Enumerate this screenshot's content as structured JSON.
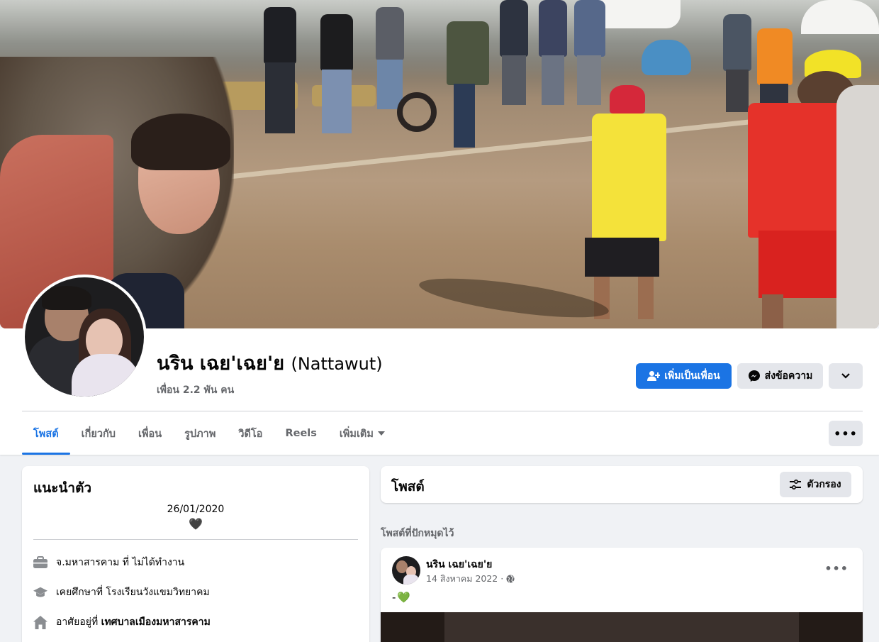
{
  "colors": {
    "accent": "#1b74e4",
    "secondary_button_bg": "#e4e6eb",
    "page_bg": "#f0f2f5",
    "muted_text": "#65676b"
  },
  "profile": {
    "name": "นริน เฉย'เฉย'ย",
    "alternate_name": "(Nattawut)",
    "friends_count": "เพื่อน 2.2 พัน คน",
    "actions": {
      "add_friend": "เพิ่มเป็นเพื่อน",
      "message": "ส่งข้อความ"
    }
  },
  "tabs": [
    {
      "label": "โพสต์",
      "active": true
    },
    {
      "label": "เกี่ยวกับ"
    },
    {
      "label": "เพื่อน"
    },
    {
      "label": "รูปภาพ"
    },
    {
      "label": "วิดีโอ"
    },
    {
      "label": "Reels"
    },
    {
      "label": "เพิ่มเติม"
    }
  ],
  "intro": {
    "title": "แนะนำตัว",
    "bio_date": "26/01/2020",
    "bio_symbol": "🖤",
    "work": "จ.มหาสารคาม ที่ ไม่ได้ทำงาน",
    "education": "เคยศึกษาที่ โรงเรียนวังแขมวิทยาคม",
    "lives_prefix": "อาศัยอยู่ที่",
    "lives_place": "เทศบาลเมืองมหาสารคาม"
  },
  "posts": {
    "title": "โพสต์",
    "filter_label": "ตัวกรอง",
    "pinned_label": "โพสต์ที่ปักหมุดไว้",
    "pinned_post": {
      "author": "นริน เฉย'เฉย'ย",
      "date": "14 สิงหาคม 2022 ·",
      "text": "-",
      "emoji": "💚"
    }
  },
  "icons": [
    "user-plus-icon",
    "messenger-icon",
    "chevron-down-icon",
    "more-dots-icon",
    "caret-down-icon",
    "briefcase-icon",
    "graduation-cap-icon",
    "home-icon",
    "filter-icon",
    "globe-icon"
  ]
}
